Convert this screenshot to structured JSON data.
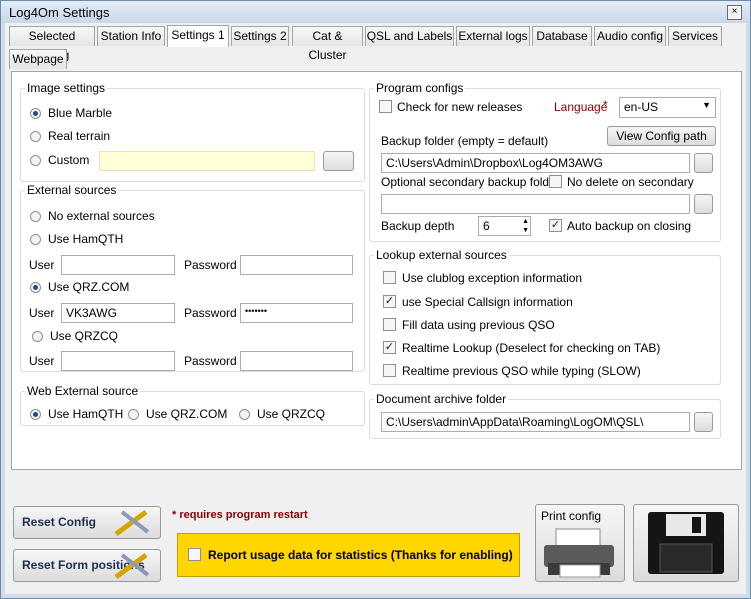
{
  "window": {
    "title": "Log4Om Settings",
    "close_glyph": "×"
  },
  "tabs": [
    "Selected Config",
    "Station Info",
    "Settings 1",
    "Settings 2",
    "Cat & Cluster",
    "QSL and Labels",
    "External logs",
    "Database",
    "Audio config",
    "Services",
    "Webpage"
  ],
  "image_settings": {
    "title": "Image settings",
    "options": [
      "Blue Marble",
      "Real terrain",
      "Custom"
    ],
    "selected": "Blue Marble",
    "custom_value": ""
  },
  "external_sources": {
    "title": "External sources",
    "opt_none": "No external sources",
    "opt_hamqth": "Use HamQTH",
    "opt_qrz": "Use QRZ.COM",
    "opt_qrzcq": "Use QRZCQ",
    "selected": "Use QRZ.COM",
    "user_label": "User",
    "password_label": "Password",
    "hamqth_user": "",
    "hamqth_password": "",
    "qrz_user": "VK3AWG",
    "qrz_password": "•••••••",
    "qrzcq_user": "",
    "qrzcq_password": ""
  },
  "web_external": {
    "title": "Web External source",
    "options": [
      "Use HamQTH",
      "Use QRZ.COM",
      "Use QRZCQ"
    ],
    "selected": "Use HamQTH"
  },
  "program_configs": {
    "title": "Program configs",
    "check_releases": "Check for new releases",
    "check_releases_on": false,
    "language_label": "Language",
    "required_mark": "*",
    "language_value": "en-US",
    "view_config_path": "View Config path",
    "backup_folder_label": "Backup folder (empty = default)",
    "backup_folder_value": "C:\\Users\\Admin\\Dropbox\\Log4OM3AWG",
    "secondary_label": "Optional secondary backup folder",
    "no_delete_label": "No delete on secondary",
    "no_delete_on": false,
    "secondary_value": "",
    "backup_depth_label": "Backup depth",
    "backup_depth_value": "6",
    "auto_backup_label": "Auto backup on closing",
    "auto_backup_on": true
  },
  "lookup": {
    "title": "Lookup external sources",
    "items": [
      {
        "label": "Use clublog exception information",
        "checked": false
      },
      {
        "label": "use Special Callsign information",
        "checked": true
      },
      {
        "label": "Fill data using previous QSO",
        "checked": false
      },
      {
        "label": "Realtime Lookup (Deselect for checking on TAB)",
        "checked": true
      },
      {
        "label": "Realtime previous QSO while typing (SLOW)",
        "checked": false
      }
    ]
  },
  "document_archive": {
    "title": "Document archive folder",
    "value": "C:\\Users\\admin\\AppData\\Roaming\\LogOM\\QSL\\"
  },
  "bottom": {
    "reset_config": "Reset Config",
    "reset_form_positions": "Reset Form positions",
    "requires_restart": "* requires program restart",
    "report_usage": "Report usage data for statistics (Thanks for enabling)",
    "report_usage_on": false,
    "print_config": "Print config"
  },
  "colors": {
    "accent": "#1f4c8a",
    "required_text": "#8b0000",
    "report_bg": "#ffd600",
    "custom_field_bg": "#ffffd8"
  }
}
